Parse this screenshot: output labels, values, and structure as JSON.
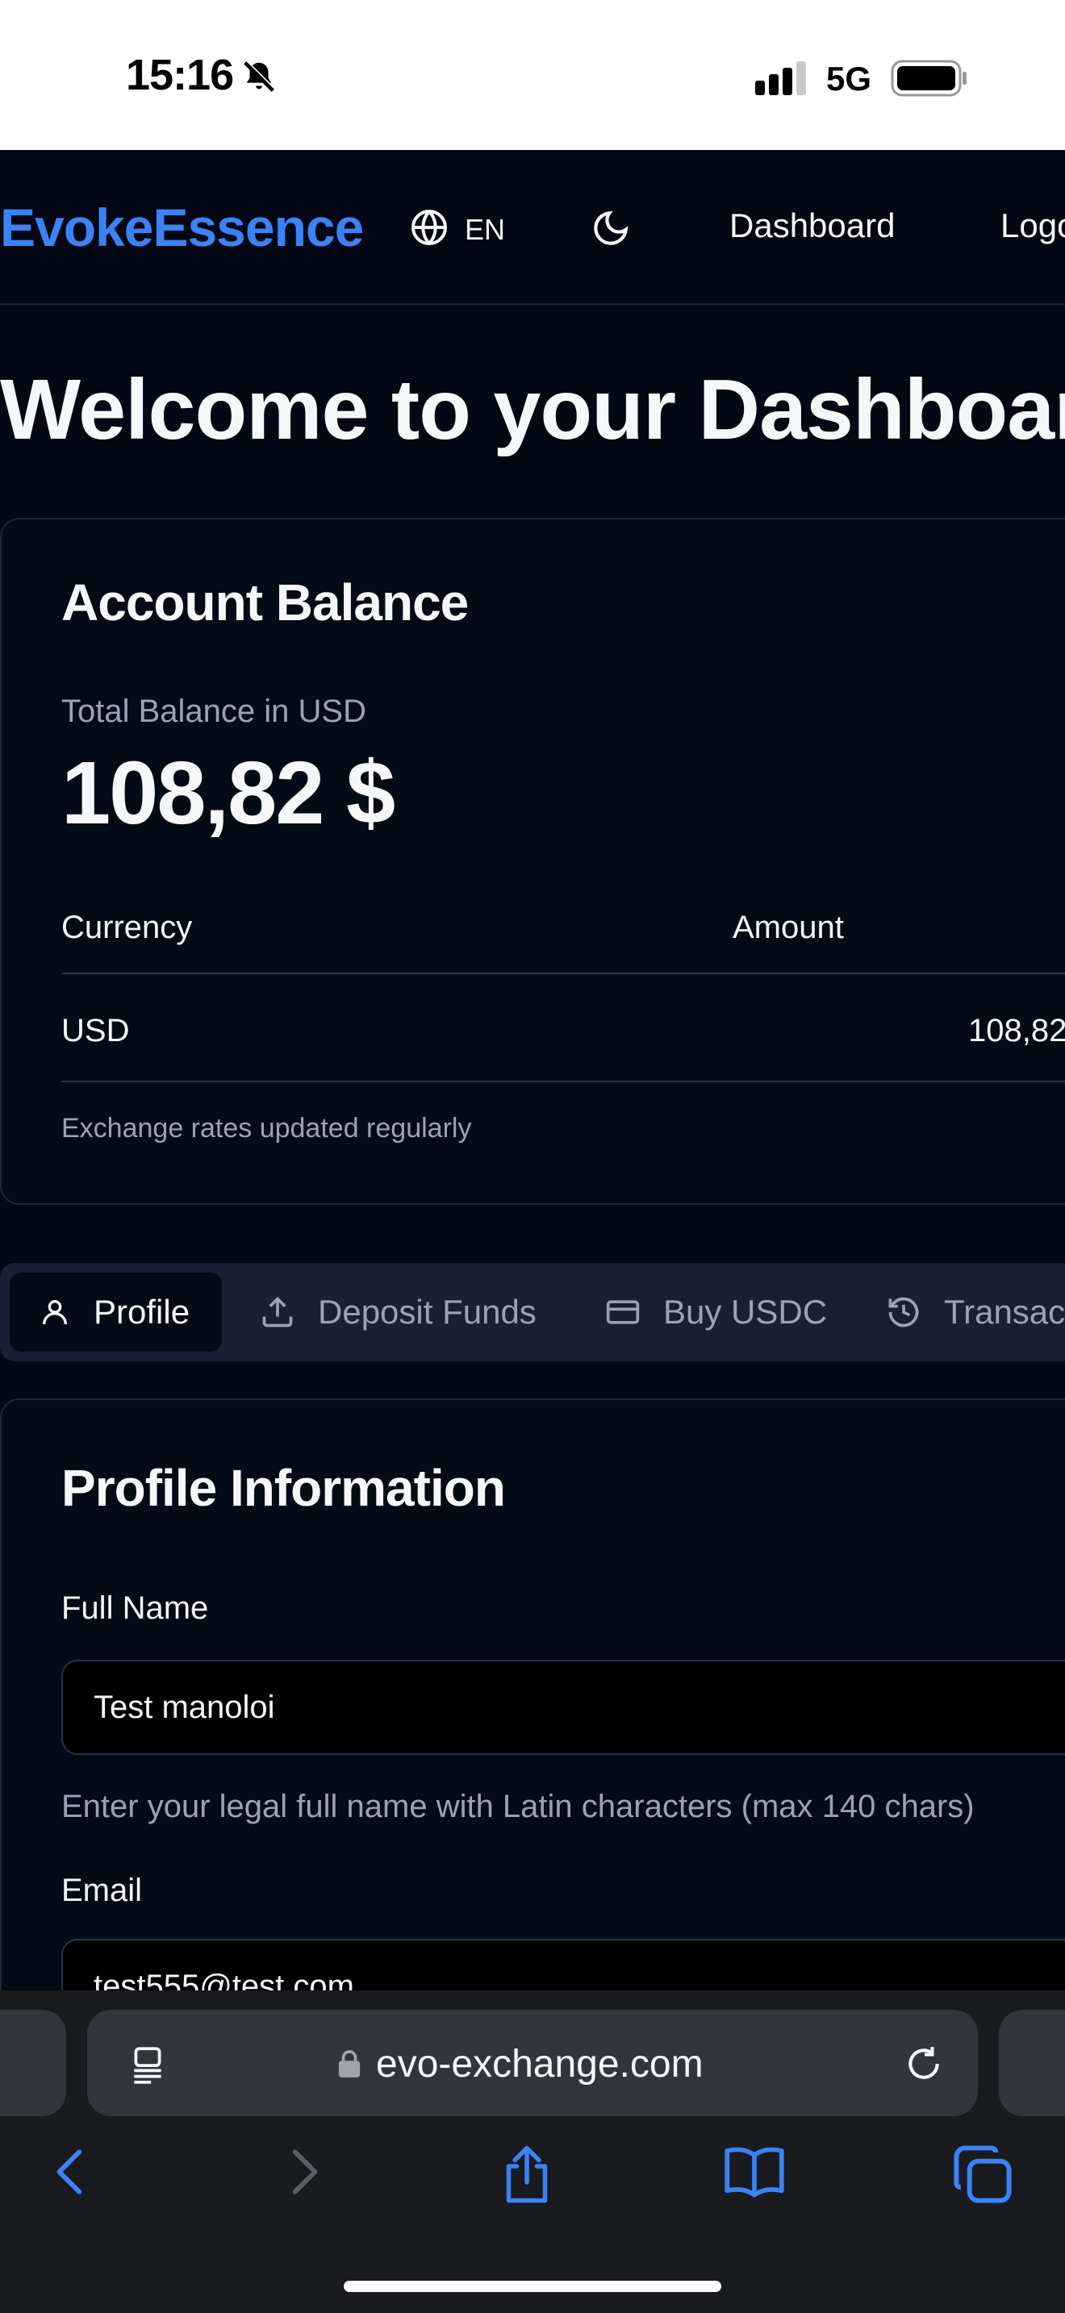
{
  "status_bar": {
    "time": "15:16",
    "network": "5G"
  },
  "nav": {
    "brand": "EvokeEssence",
    "language": "EN",
    "links": [
      "Dashboard",
      "Logo"
    ]
  },
  "page_title": "Welcome to your Dashboar",
  "balance": {
    "title": "Account Balance",
    "total_label": "Total Balance in USD",
    "total_value": "108,82 $",
    "columns": [
      "Currency",
      "Amount"
    ],
    "rows": [
      {
        "currency": "USD",
        "amount": "108,82"
      }
    ],
    "note": "Exchange rates updated regularly"
  },
  "tabs": [
    {
      "label": "Profile",
      "icon": "user-icon",
      "active": true
    },
    {
      "label": "Deposit Funds",
      "icon": "upload-icon",
      "active": false
    },
    {
      "label": "Buy USDC",
      "icon": "credit-card-icon",
      "active": false
    },
    {
      "label": "Transac",
      "icon": "history-icon",
      "active": false
    }
  ],
  "profile": {
    "title": "Profile Information",
    "full_name_label": "Full Name",
    "full_name_value": "Test manoloi",
    "full_name_help": "Enter your legal full name with Latin characters (max 140 chars)",
    "email_label": "Email",
    "email_value": "test555@test.com"
  },
  "browser": {
    "url": "evo-exchange.com"
  },
  "colors": {
    "background": "#040814",
    "brand": "#3b82f6",
    "border": "#1f2636",
    "tabs_bg": "#1a2031",
    "safari_accent": "#3b82f6"
  }
}
